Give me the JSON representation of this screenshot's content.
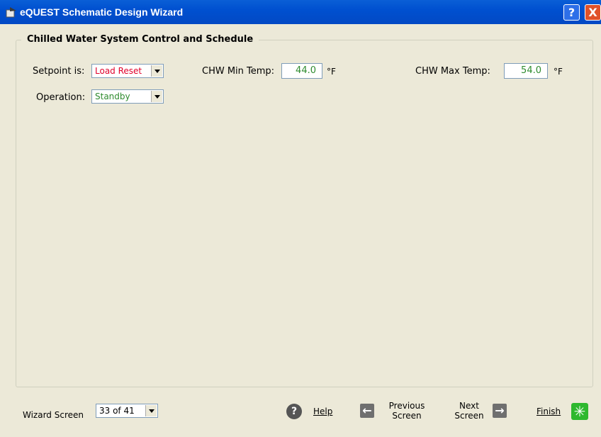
{
  "window": {
    "title": "eQUEST Schematic Design Wizard",
    "help_label": "?",
    "close_label": "X"
  },
  "group": {
    "title": "Chilled Water System Control and Schedule"
  },
  "setpoint": {
    "label": "Setpoint is:",
    "value": "Load Reset",
    "color": "#e0002a"
  },
  "operation": {
    "label": "Operation:",
    "value": "Standby",
    "color": "#2e8b2e"
  },
  "chw_min": {
    "label": "CHW Min Temp:",
    "value": "44.0",
    "unit": "°F"
  },
  "chw_max": {
    "label": "CHW Max Temp:",
    "value": "54.0",
    "unit": "°F"
  },
  "footer": {
    "wizard_label": "Wizard Screen",
    "wizard_value": "33 of 41",
    "help": "Help",
    "previous_line1": "Previous",
    "previous_line2": "Screen",
    "next_line1": "Next",
    "next_line2": "Screen",
    "finish": "Finish"
  }
}
